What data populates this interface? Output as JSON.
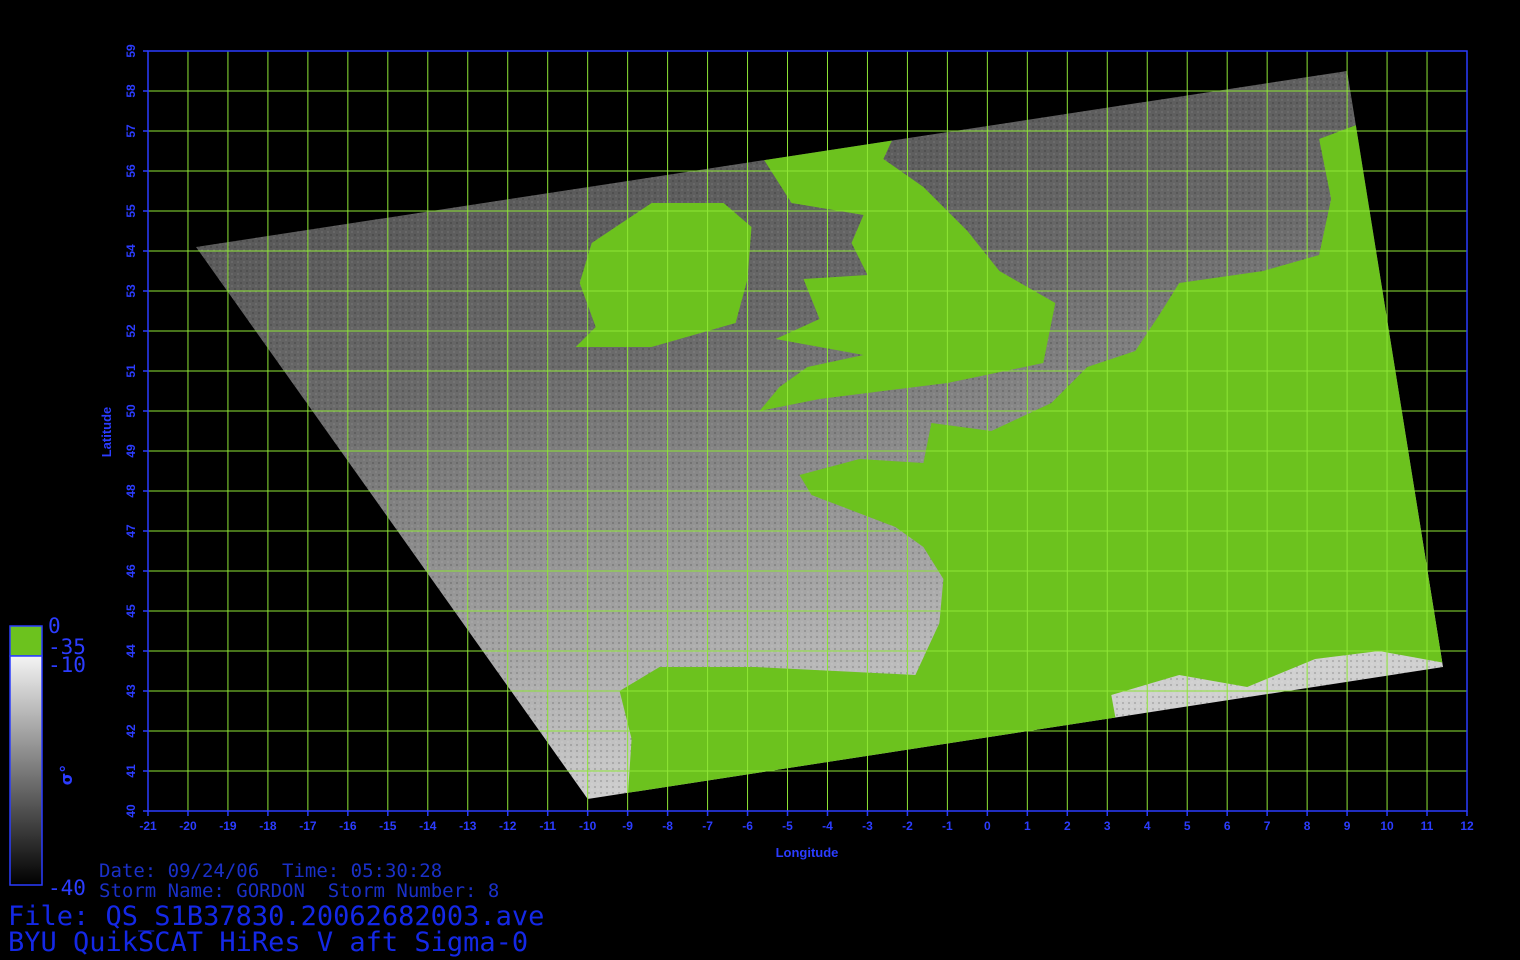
{
  "map": {
    "xlabel": "Longitude",
    "ylabel": "Latitude",
    "lon_range": [
      -21,
      12
    ],
    "lat_range": [
      40,
      59
    ],
    "lon_ticks": [
      -21,
      -20,
      -19,
      -18,
      -17,
      -16,
      -15,
      -14,
      -13,
      -12,
      -11,
      -10,
      -9,
      -8,
      -7,
      -6,
      -5,
      -4,
      -3,
      -2,
      -1,
      0,
      1,
      2,
      3,
      4,
      5,
      6,
      7,
      8,
      9,
      10,
      11,
      12
    ],
    "lat_ticks": [
      40,
      41,
      42,
      43,
      44,
      45,
      46,
      47,
      48,
      49,
      50,
      51,
      52,
      53,
      54,
      55,
      56,
      57,
      58,
      59
    ],
    "grid": true,
    "colors": {
      "grid": "#8ee636",
      "axis": "#2b3cff",
      "land": "#6cc21e",
      "background": "#000000"
    },
    "swath_corners": [
      [
        -19.8,
        54.1
      ],
      [
        9,
        58.5
      ],
      [
        11.4,
        43.6
      ],
      [
        -10,
        40.3
      ]
    ]
  },
  "colorbar": {
    "label": "σ°",
    "top_label": "0",
    "mid_label_1": "-35",
    "mid_label_2": "-10",
    "bottom_label": "-40"
  },
  "info": {
    "date_line": "Date: 09/24/06  Time: 05:30:28",
    "storm_line": "Storm Name: GORDON  Storm Number: 8",
    "file_line": "File: QS_S1B37830.20062682003.ave",
    "product_line": "BYU QuikSCAT HiRes V aft Sigma-0"
  }
}
